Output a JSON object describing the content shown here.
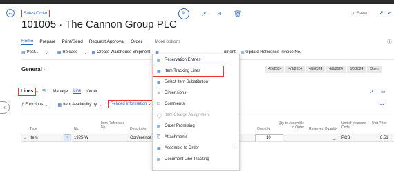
{
  "page": {
    "caption": "Sales Order",
    "title": "101005 · The Cannon Group PLC",
    "saved": "Saved"
  },
  "nav": {
    "tabs": [
      "Home",
      "Prepare",
      "Print/Send",
      "Request Approval",
      "Order"
    ],
    "more": "More options"
  },
  "actions": {
    "post": "Post...",
    "release": "Release",
    "create_shipment": "Create Warehouse Shipment",
    "partial": "ument",
    "update_invoice": "Update Reference Invoice No."
  },
  "general": {
    "label": "General",
    "dates": [
      "4/9/2024",
      "4/9/2024",
      "4/9/2024",
      "4/9/2024",
      "3/6/2024",
      "Open"
    ]
  },
  "lines": {
    "label": "Lines",
    "manage": "Manage",
    "line": "Line",
    "order": "Order",
    "functions": "Functions",
    "item_availability": "Item Availability by",
    "related_information": "Related Information"
  },
  "table": {
    "headers": {
      "type": "Type",
      "no": "No.",
      "item_ref": "Item Reference No.",
      "description": "Description",
      "quantity": "Quantity",
      "qty_assemble": "Qty. to Assemble to Order",
      "reserved": "Reserved Quantity",
      "uom": "Unit of Measure Code",
      "unit_price": "Unit Price"
    },
    "row": {
      "type": "Item",
      "no": "1925-W",
      "description": "Conference Bu",
      "quantity": "10",
      "reserved": "_",
      "uom": "PCS",
      "unit_price": "8,51"
    }
  },
  "menu": {
    "items": [
      {
        "label": "Reservation Entries",
        "icon": "ledger-icon",
        "disabled": false
      },
      {
        "label": "Item Tracking Lines",
        "icon": "tracking-icon",
        "disabled": false
      },
      {
        "label": "Select Item Substitution",
        "icon": "substitution-icon",
        "disabled": false
      },
      {
        "label": "Dimensions",
        "icon": "dimensions-icon",
        "disabled": false
      },
      {
        "label": "Comments",
        "icon": "comment-icon",
        "disabled": false
      },
      {
        "label": "Item Charge Assignment",
        "icon": "charge-icon",
        "disabled": true
      },
      {
        "label": "Order Promising",
        "icon": "promising-icon",
        "disabled": false
      },
      {
        "label": "Attachments",
        "icon": "attachment-icon",
        "disabled": false
      },
      {
        "label": "Assemble to Order",
        "icon": "assemble-icon",
        "disabled": false,
        "submenu": true
      },
      {
        "label": "Document Line Tracking",
        "icon": "document-tracking-icon",
        "disabled": false
      }
    ]
  },
  "colors": {
    "accent": "#2f66b3",
    "highlight": "#e53935"
  }
}
